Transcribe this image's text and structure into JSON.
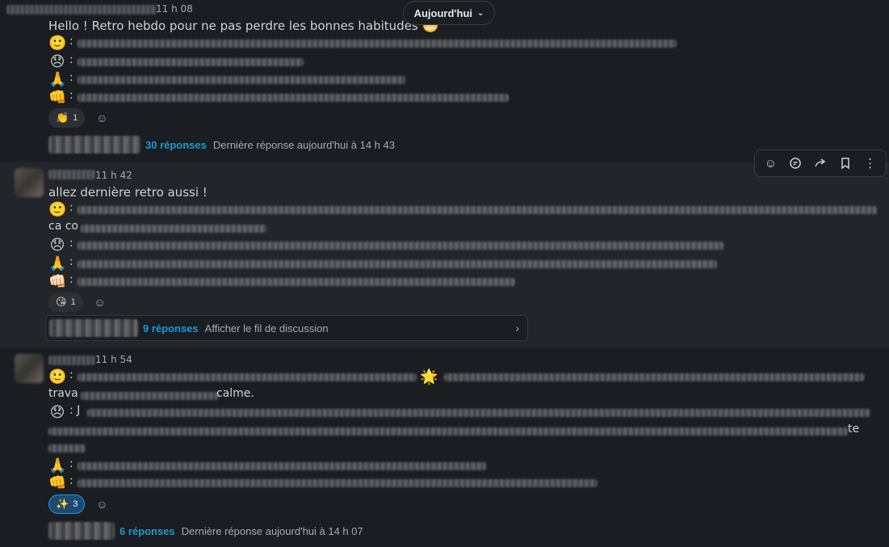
{
  "date_divider": {
    "label": "Aujourd'hui",
    "chevron_icon": "chevron-down-icon"
  },
  "toolbar": {
    "icons": [
      "add-reaction-icon",
      "reply-in-thread-icon",
      "share-icon",
      "bookmark-icon",
      "more-actions-icon"
    ]
  },
  "messages": [
    {
      "time": "11 h 08",
      "text": "Hello ! Retro hebdo pour ne pas perdre les bonnes habitudes",
      "text_emoji": "😬",
      "lines": [
        {
          "emoji": "🙂",
          "sep": ":"
        },
        {
          "emoji": "😞",
          "sep": ":"
        },
        {
          "emoji": "🙏",
          "sep": ":"
        },
        {
          "emoji": "👊",
          "sep": ":"
        }
      ],
      "reactions": [
        {
          "emoji": "👏",
          "count": "1"
        }
      ],
      "thread": {
        "count": "30 réponses",
        "meta": "Dernière réponse aujourd'hui à 14 h 43"
      }
    },
    {
      "time": "11 h 42",
      "text": "allez dernière retro aussi !",
      "lines": [
        {
          "emoji": "🙂",
          "sep": ":"
        },
        {
          "fragment": "ca co"
        },
        {
          "emoji": "😞",
          "sep": ":"
        },
        {
          "emoji": "🙏",
          "sep": ":"
        },
        {
          "emoji": "👊🏻",
          "sep": ":"
        }
      ],
      "reactions": [
        {
          "emoji": "😘",
          "count": "1"
        }
      ],
      "thread": {
        "count": "9 réponses",
        "meta": "Afficher le fil de discussion",
        "chevron_icon": "chevron-right-icon"
      }
    },
    {
      "time": "11 h 54",
      "lines": [
        {
          "emoji": "🙂",
          "sep": ":",
          "mid_emoji": "🌟"
        },
        {
          "fragment": "trava",
          "fragment_end": "calme."
        },
        {
          "emoji": "😞",
          "sep": ": J"
        },
        {
          "fragment_end": "te"
        },
        {
          "emoji": "🙏",
          "sep": ":"
        },
        {
          "emoji": "👊",
          "sep": ":"
        }
      ],
      "reactions": [
        {
          "emoji": "✨",
          "count": "3",
          "active": true
        }
      ],
      "thread": {
        "count": "6 réponses",
        "meta": "Dernière réponse aujourd'hui à 14 h 07"
      }
    }
  ]
}
